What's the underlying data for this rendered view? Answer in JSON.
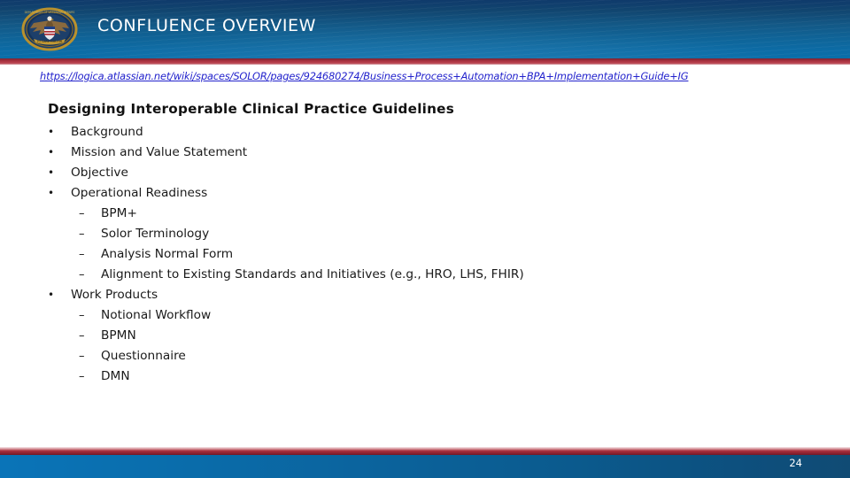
{
  "header": {
    "title": "CONFLUENCE OVERVIEW",
    "seal_icon": "va-seal-icon",
    "band_color_top": "#0f3a6b",
    "band_color_bottom": "#0a6ea9",
    "rule_color": "#a8313f"
  },
  "link": {
    "url": "https://logica.atlassian.net/wiki/spaces/SOLOR/pages/924680274/Business+Process+Automation+BPA+Implementation+Guide+IG",
    "color": "#2222cc"
  },
  "content": {
    "heading": "Designing Interoperable Clinical Practice Guidelines",
    "bullet_marker": "•",
    "dash_marker": "–",
    "items": [
      {
        "level": 1,
        "text": "Background"
      },
      {
        "level": 1,
        "text": "Mission and Value Statement"
      },
      {
        "level": 1,
        "text": "Objective"
      },
      {
        "level": 1,
        "text": "Operational Readiness"
      },
      {
        "level": 2,
        "text": "BPM+"
      },
      {
        "level": 2,
        "text": "Solor Terminology"
      },
      {
        "level": 2,
        "text": "Analysis Normal Form"
      },
      {
        "level": 2,
        "text": "Alignment to Existing Standards and Initiatives (e.g., HRO, LHS, FHIR)"
      },
      {
        "level": 1,
        "text": "Work Products"
      },
      {
        "level": 2,
        "text": "Notional Workflow"
      },
      {
        "level": 2,
        "text": "BPMN"
      },
      {
        "level": 2,
        "text": "Questionnaire"
      },
      {
        "level": 2,
        "text": "DMN"
      }
    ]
  },
  "footer": {
    "slide_number": "24",
    "rule_color": "#a9313f",
    "band_color_left": "#0a74b8",
    "band_color_right": "#104b74"
  }
}
